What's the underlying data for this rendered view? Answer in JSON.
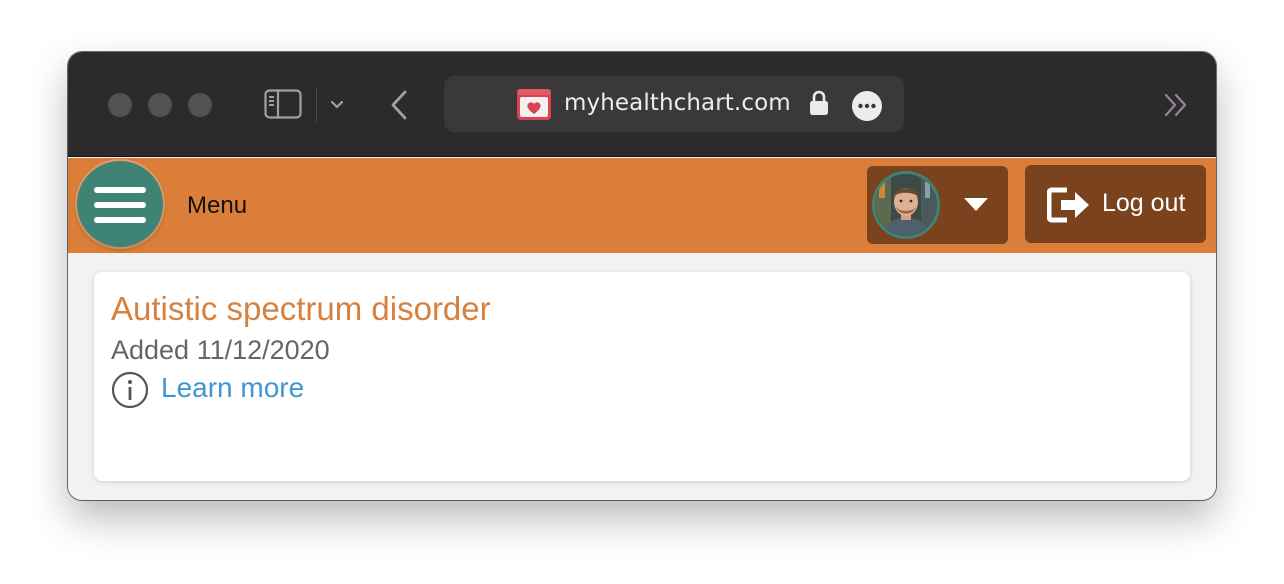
{
  "browser": {
    "url": "myhealthchart.com",
    "icons": {
      "sidebar": "sidebar-icon",
      "tab_menu": "chevron-down-icon",
      "back": "chevron-left-icon",
      "site": "health-chart-favicon",
      "secure": "lock-icon",
      "page_actions": "more-icon",
      "overflow": "double-chevron-right-icon"
    }
  },
  "header": {
    "menu_label": "Menu",
    "menu_icon": "hamburger-icon",
    "profile_icon": "caret-down-icon",
    "logout_label": "Log out",
    "logout_icon": "logout-icon"
  },
  "condition": {
    "title": "Autistic spectrum disorder",
    "added": "Added 11/12/2020",
    "learn_more": "Learn more",
    "info_icon": "info-icon"
  },
  "colors": {
    "header_bg": "#db7e3a",
    "menu_button_bg": "#3e8374",
    "header_button_bg": "#7a421d",
    "condition_title": "#d6813f",
    "link": "#3f97cf",
    "secondary_text": "#666666"
  }
}
